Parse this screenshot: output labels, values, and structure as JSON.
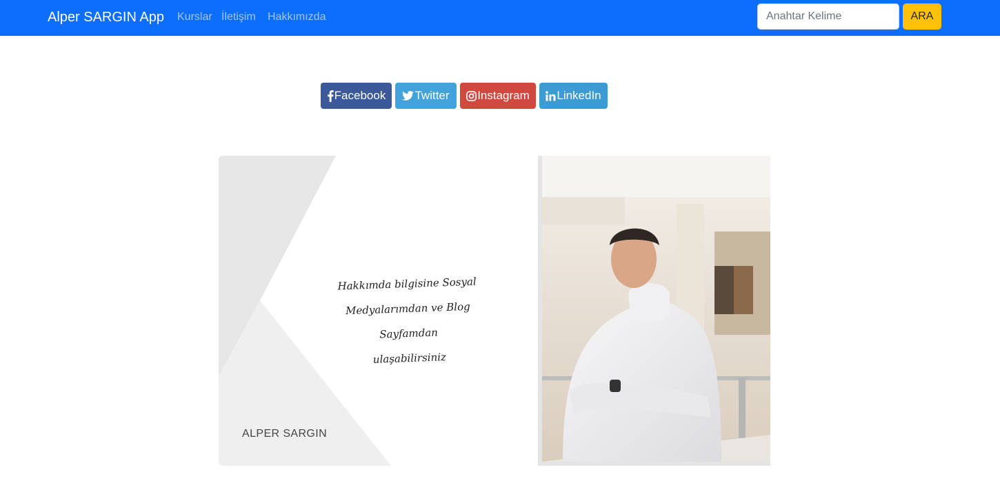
{
  "navbar": {
    "brand": "Alper SARGIN App",
    "links": [
      {
        "label": "Kurslar"
      },
      {
        "label": "İletişim"
      },
      {
        "label": "Hakkımızda"
      }
    ],
    "search": {
      "placeholder": "Anahtar Kelime",
      "value": "",
      "button_label": "ARA"
    },
    "background_color": "#0d6efd",
    "button_color": "#ffc107"
  },
  "social_buttons": [
    {
      "label": "Facebook",
      "icon": "facebook-icon",
      "color": "#3b5998"
    },
    {
      "label": "Twitter",
      "icon": "twitter-icon",
      "color": "#42a2d9"
    },
    {
      "label": "Instagram",
      "icon": "instagram-icon",
      "color": "#d0483e"
    },
    {
      "label": "LinkedIn",
      "icon": "linkedin-icon",
      "color": "#3d9bd4"
    }
  ],
  "about_card": {
    "quote_lines": [
      "Hakkımda bilgisine Sosyal",
      "Medyalarımdan ve Blog Sayfamdan",
      "ulaşabilirsiniz"
    ],
    "name": "ALPER SARGIN"
  },
  "photo": {
    "subject": "portrait-photo"
  }
}
